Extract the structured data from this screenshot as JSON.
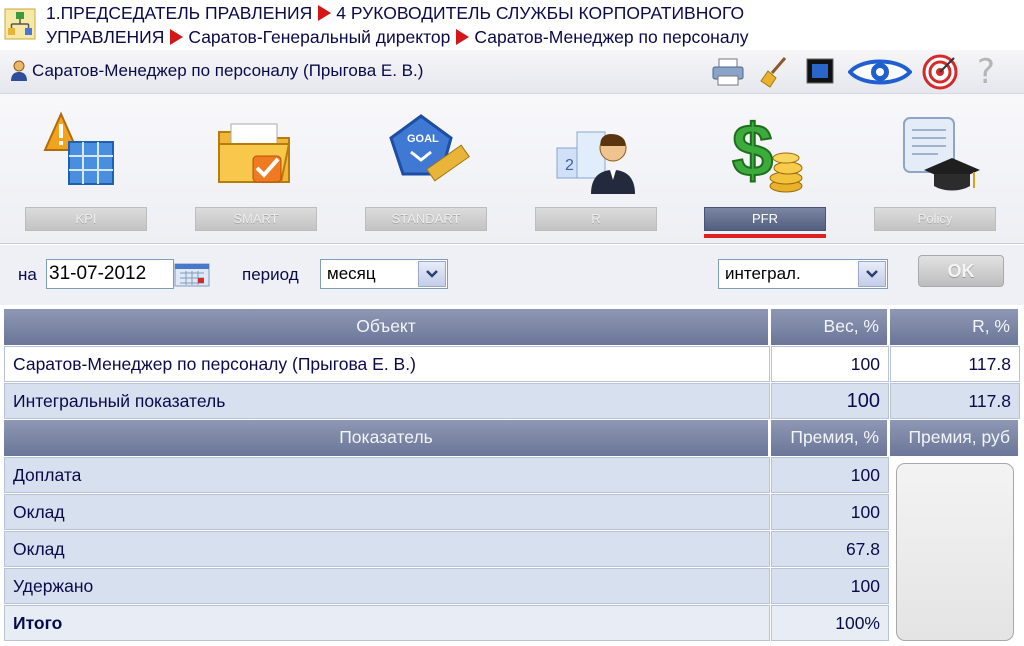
{
  "breadcrumb": {
    "line1_part1": "1.ПРЕДСЕДАТЕЛЬ ПРАВЛЕНИЯ",
    "line1_part2": "4 РУКОВОДИТЕЛЬ СЛУЖБЫ КОРПОРАТИВНОГО",
    "line2_part1": "УПРАВЛЕНИЯ",
    "line2_part2": "Саратов-Генеральный директор",
    "line2_part3": "Саратов-Менеджер по персоналу",
    "arrow_color": "#d41616"
  },
  "titlebar": {
    "title": "Саратов-Менеджер по персоналу  (Прыгова Е. В.)",
    "tools": [
      "printer-icon",
      "broom-icon",
      "monitor-icon",
      "eye-icon",
      "target-icon",
      "help-icon"
    ],
    "help_glyph": "?"
  },
  "modules": [
    {
      "label": "KPI",
      "icon": "kpi-warning-table-icon",
      "active": false
    },
    {
      "label": "SMART",
      "icon": "folder-check-icon",
      "active": false
    },
    {
      "label": "STANDART",
      "icon": "goal-ruler-icon",
      "active": false
    },
    {
      "label": "R",
      "icon": "podium-person-icon",
      "active": false
    },
    {
      "label": "PFR",
      "icon": "dollar-coins-icon",
      "active": true
    },
    {
      "label": "Policy",
      "icon": "scroll-graduation-icon",
      "active": false
    }
  ],
  "controls": {
    "date_label": "на",
    "date_value": "31-07-2012",
    "period_label": "период",
    "period_value": "месяц",
    "mode_value": "интеграл.",
    "ok_label": "OK"
  },
  "table": {
    "header1": {
      "object": "Объект",
      "weight": "Вес, %",
      "r": "R, %"
    },
    "objects": [
      {
        "name": "Саратов-Менеджер по персоналу (Прыгова Е. В.)",
        "weight": "100",
        "r": "117.8"
      },
      {
        "name": "Интегральный показатель",
        "weight": "100",
        "r": "117.8"
      }
    ],
    "header2": {
      "indicator": "Показатель",
      "bonus_pct": "Премия, %",
      "bonus_rub": "Премия, руб"
    },
    "indicators": [
      {
        "name": "Доплата",
        "bonus_pct": "100"
      },
      {
        "name": "Оклад",
        "bonus_pct": "100"
      },
      {
        "name": "Оклад",
        "bonus_pct": "67.8"
      },
      {
        "name": "Удержано",
        "bonus_pct": "100"
      }
    ],
    "total": {
      "name": "Итого",
      "bonus_pct": "100%"
    }
  }
}
